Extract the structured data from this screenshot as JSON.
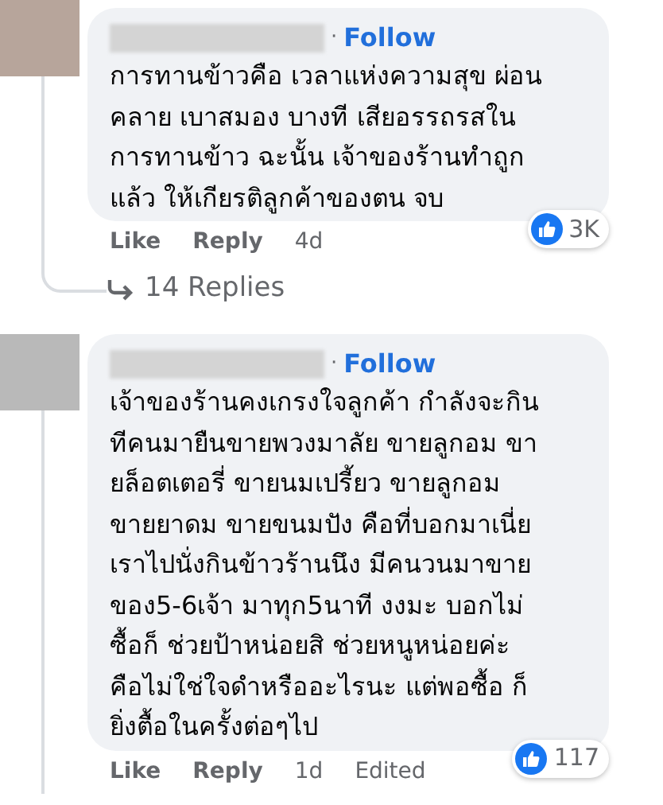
{
  "comments": [
    {
      "separator": "·",
      "follow": "Follow",
      "text": "การทานข้าวคือ เวลาแห่งความสุข ผ่อน\nคลาย เบาสมอง บางที เสียอรรถรสใน\nการทานข้าว ฉะนั้น เจ้าของร้านทำถูก\nแล้ว ให้เกียรติลูกค้าของตน จบ",
      "reactions": "3K",
      "actions": [
        "Like",
        "Reply"
      ],
      "time": "4d",
      "replies": "14 Replies"
    },
    {
      "separator": "·",
      "follow": "Follow",
      "text": "เจ้าของร้านคงเกรงใจลูกค้า กำลังจะกิน\nทีคนมายืนขายพวงมาลัย ขายลูกอม ขา\nยล็อตเตอรี่ ขายนมเปรี้ยว ขายลูกอม\nขายยาดม ขายขนมปัง คือที่บอกมาเนี่ย\nเราไปนั่งกินข้าวร้านนึง มีคนวนมาขาย\nของ5-6เจ้า มาทุก5นาที งงมะ บอกไม่\nซื้อก็ ช่วยป้าหน่อยสิ ช่วยหนูหน่อยค่ะ\nคือไม่ใช่ใจดำหรืออะไรนะ แต่พอซื้อ ก็\nยิ่งตื้อในครั้งต่อๆไป",
      "reactions": "117",
      "actions": [
        "Like",
        "Reply"
      ],
      "time": "1d",
      "edited": "Edited"
    }
  ]
}
